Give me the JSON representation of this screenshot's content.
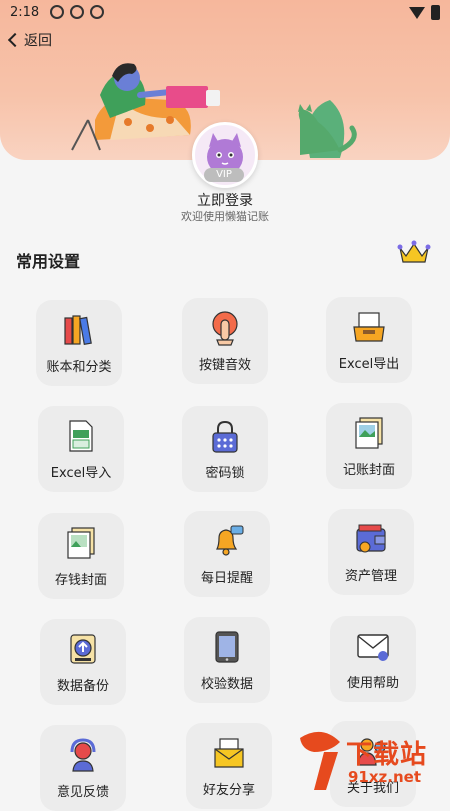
{
  "status_bar": {
    "time": "2:18"
  },
  "nav": {
    "back_label": "返回"
  },
  "profile": {
    "vip_label": "VIP",
    "login_label": "立即登录",
    "welcome_text": "欢迎使用懒猫记账"
  },
  "settings": {
    "title": "常用设置",
    "items": [
      {
        "label": "账本和分类",
        "icon": "books-icon"
      },
      {
        "label": "按键音效",
        "icon": "tap-sound-icon"
      },
      {
        "label": "Excel导出",
        "icon": "export-tray-icon"
      },
      {
        "label": "Excel导入",
        "icon": "excel-file-icon"
      },
      {
        "label": "密码锁",
        "icon": "lock-icon"
      },
      {
        "label": "记账封面",
        "icon": "cover-image-icon"
      },
      {
        "label": "存钱封面",
        "icon": "savings-cover-icon"
      },
      {
        "label": "每日提醒",
        "icon": "bell-icon"
      },
      {
        "label": "资产管理",
        "icon": "wallet-icon"
      },
      {
        "label": "数据备份",
        "icon": "backup-icon"
      },
      {
        "label": "校验数据",
        "icon": "tablet-icon"
      },
      {
        "label": "使用帮助",
        "icon": "mail-help-icon"
      },
      {
        "label": "意见反馈",
        "icon": "headset-icon"
      },
      {
        "label": "好友分享",
        "icon": "share-letter-icon"
      },
      {
        "label": "关于我们",
        "icon": "people-icon"
      }
    ]
  },
  "watermark": {
    "text": "下载站",
    "url": "91xz.net"
  },
  "colors": {
    "header": "#f6b79c",
    "tile": "#ececec",
    "background": "#f5f5f5",
    "watermark": "#e64a1e"
  }
}
